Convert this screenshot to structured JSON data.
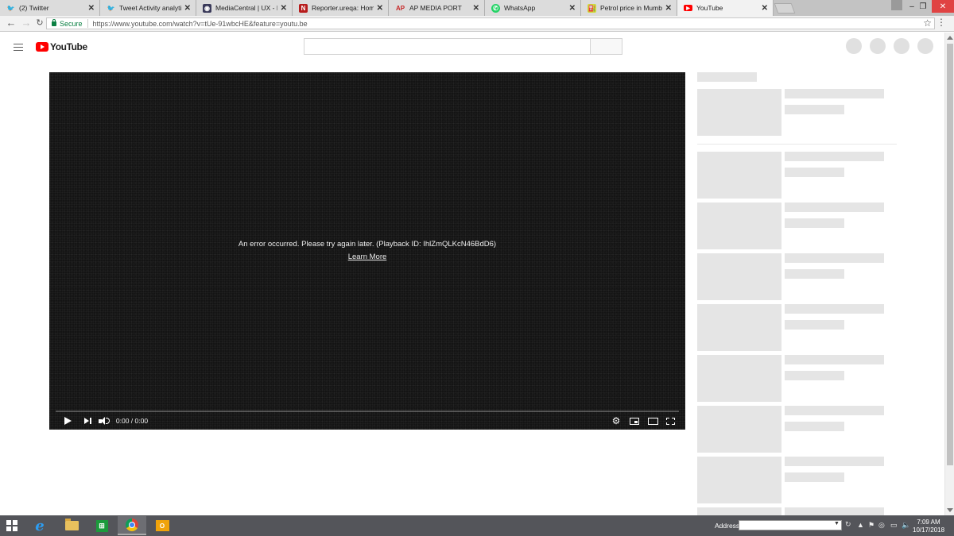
{
  "browser": {
    "tabs": [
      {
        "title": "(2) Twitter",
        "favicon": "twitter-icon",
        "active": false
      },
      {
        "title": "Tweet Activity analytics f",
        "favicon": "twitter-icon",
        "active": false
      },
      {
        "title": "MediaCentral | UX - Rund",
        "favicon": "mediacentral-icon",
        "active": false
      },
      {
        "title": "Reporter.ureqa: Home",
        "favicon": "reporter-icon",
        "favicon_text": "N",
        "active": false
      },
      {
        "title": "AP MEDIA PORT",
        "favicon": "ap-icon",
        "favicon_text": "AP",
        "active": false
      },
      {
        "title": "WhatsApp",
        "favicon": "whatsapp-icon",
        "active": false
      },
      {
        "title": "Petrol price in Mumbai |",
        "favicon": "petrol-icon",
        "active": false
      },
      {
        "title": "YouTube",
        "favicon": "youtube-icon",
        "active": true
      }
    ],
    "secure_label": "Secure",
    "url": "https://www.youtube.com/watch?v=tUe-91wbcHE&feature=youtu.be"
  },
  "youtube": {
    "logo_text": "YouTube",
    "player": {
      "error_message": "An error occurred. Please try again later. (Playback ID: IhlZmQLKcN46BdD6)",
      "learn_more": "Learn More",
      "time": "0:00 / 0:00"
    }
  },
  "taskbar": {
    "address_label": "Address",
    "clock_time": "7:09 AM",
    "clock_date": "10/17/2018"
  },
  "colors": {
    "youtube_red": "#ff0000",
    "player_bg": "#141414",
    "skeleton": "#e5e5e5",
    "taskbar": "#54555a",
    "secure_green": "#0b8043"
  }
}
